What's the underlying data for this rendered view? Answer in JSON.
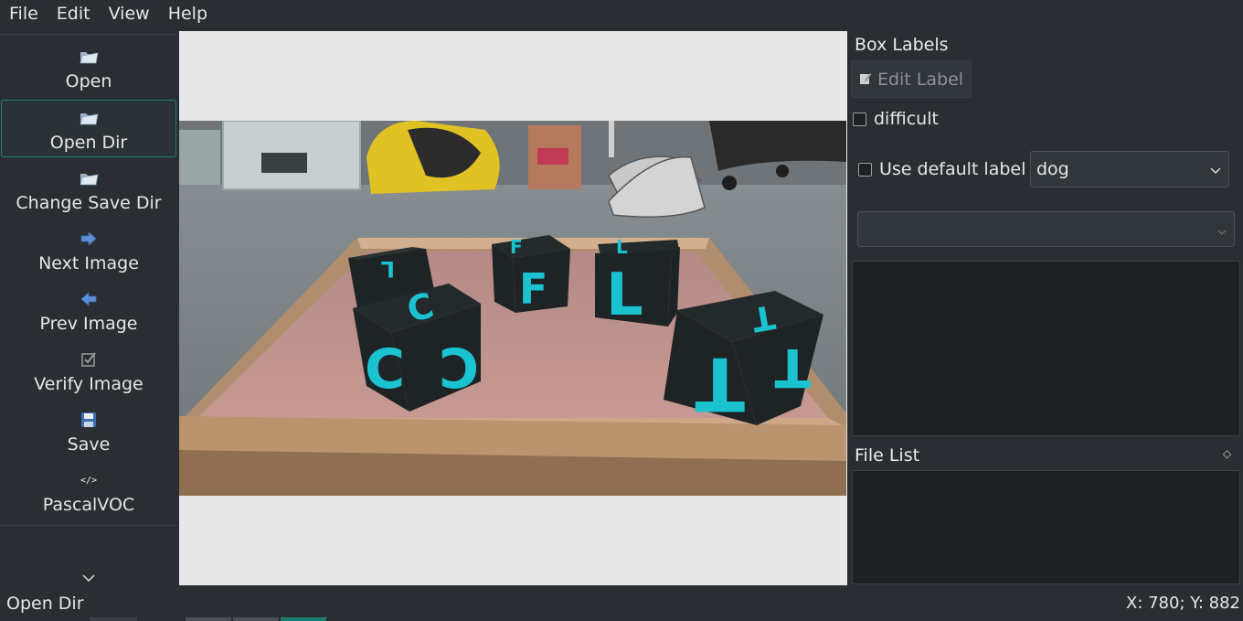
{
  "menu": [
    "File",
    "Edit",
    "View",
    "Help"
  ],
  "toolbar": {
    "items": [
      {
        "label": "Open",
        "icon": "folder-open-icon"
      },
      {
        "label": "Open Dir",
        "icon": "folder-open-icon",
        "active": true
      },
      {
        "label": "Change Save Dir",
        "icon": "folder-open-icon"
      },
      {
        "label": "Next Image",
        "icon": "arrow-right-icon"
      },
      {
        "label": "Prev Image",
        "icon": "arrow-left-icon"
      },
      {
        "label": "Verify Image",
        "icon": "checkbox-check-icon"
      },
      {
        "label": "Save",
        "icon": "floppy-disk-icon"
      },
      {
        "label": "PascalVOC",
        "icon": "code-tag-icon"
      }
    ],
    "more": "⌄"
  },
  "image": {
    "description_icon": "photo",
    "cube_letters": [
      "C",
      "F",
      "L",
      "T",
      "L"
    ]
  },
  "box_labels": {
    "title": "Box Labels",
    "edit_label": "Edit Label",
    "difficult": "difficult",
    "use_default_label": "Use default label",
    "default_label_value": "dog",
    "label_filter_value": ""
  },
  "file_list": {
    "title": "File List"
  },
  "status": {
    "left": "Open Dir",
    "right": "X: 780; Y: 882"
  },
  "colors": {
    "accent": "#1d7d74",
    "background": "#2a2e32",
    "panel": "#1e2124",
    "cube_face": "#1e2426",
    "cube_letter": "#1bc3d1"
  }
}
